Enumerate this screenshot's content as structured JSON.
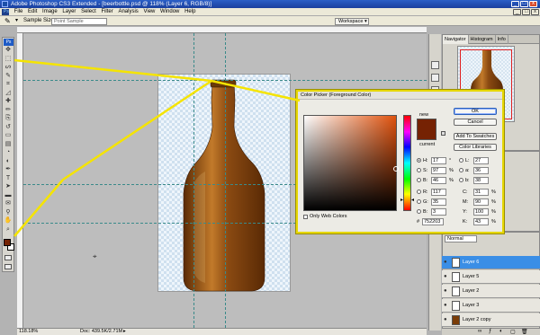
{
  "window": {
    "title": "Adobe Photoshop CS3 Extended - [beerbottle.psd @ 118% (Layer 6, RGB/8)]",
    "controls": [
      "_",
      "□",
      "x"
    ]
  },
  "menubar": {
    "app_badge": "Ps",
    "items": [
      "File",
      "Edit",
      "Image",
      "Layer",
      "Select",
      "Filter",
      "Analysis",
      "View",
      "Window",
      "Help"
    ]
  },
  "options_bar": {
    "sample_size_label": "Sample Size:",
    "sample_size_value": "Point Sample",
    "workspace_label": "Workspace"
  },
  "toolbox": {
    "badge": "Ps",
    "tools": [
      "move",
      "marquee",
      "lasso",
      "quick-select",
      "crop",
      "slice",
      "healing",
      "brush",
      "clone",
      "history-brush",
      "eraser",
      "gradient",
      "blur",
      "dodge",
      "pen",
      "type",
      "path-select",
      "shape",
      "notes",
      "eyedropper",
      "hand",
      "zoom"
    ],
    "foreground_color": "#752203",
    "background_color": "#ffffff"
  },
  "status_bar": {
    "zoom": "118.18%",
    "doc_size": "Doc: 439.5K/2.71M"
  },
  "navigator_panel": {
    "tabs": [
      "Navigator",
      "Histogram",
      "Info"
    ]
  },
  "layers_panel": {
    "blend_mode": "Normal",
    "layers": [
      {
        "name": "Layer 6",
        "selected": true
      },
      {
        "name": "Layer 5",
        "selected": false
      },
      {
        "name": "Layer 2",
        "selected": false
      },
      {
        "name": "Layer 3",
        "selected": false
      },
      {
        "name": "Layer 2 copy",
        "selected": false
      }
    ]
  },
  "color_picker": {
    "title": "Color Picker (Foreground Color)",
    "new_label": "new",
    "current_label": "current",
    "new_color": "#752203",
    "current_color": "#752203",
    "buttons": {
      "ok": "OK",
      "cancel": "Cancel",
      "add_to_swatches": "Add To Swatches",
      "color_libraries": "Color Libraries"
    },
    "only_web_colors": "Only Web Colors",
    "hsb": {
      "h": {
        "label": "H:",
        "value": "17",
        "unit": "°"
      },
      "s": {
        "label": "S:",
        "value": "97",
        "unit": "%"
      },
      "b": {
        "label": "B:",
        "value": "46",
        "unit": "%"
      }
    },
    "rgb": {
      "r": {
        "label": "R:",
        "value": "117"
      },
      "g": {
        "label": "G:",
        "value": "35"
      },
      "b": {
        "label": "B:",
        "value": "3"
      }
    },
    "lab": {
      "l": {
        "label": "L:",
        "value": "27"
      },
      "a": {
        "label": "a:",
        "value": "36"
      },
      "b": {
        "label": "b:",
        "value": "38"
      }
    },
    "cmyk": {
      "c": {
        "label": "C:",
        "value": "31",
        "unit": "%"
      },
      "m": {
        "label": "M:",
        "value": "90",
        "unit": "%"
      },
      "y": {
        "label": "Y:",
        "value": "100",
        "unit": "%"
      },
      "k": {
        "label": "K:",
        "value": "43",
        "unit": "%"
      }
    },
    "hex_label": "#",
    "hex_value": "752203"
  },
  "colors": {
    "callout_yellow": "#f5e400",
    "bottle_dark": "#5a2a05",
    "bottle_mid": "#8a4a12",
    "bottle_light": "#c27a2a"
  }
}
